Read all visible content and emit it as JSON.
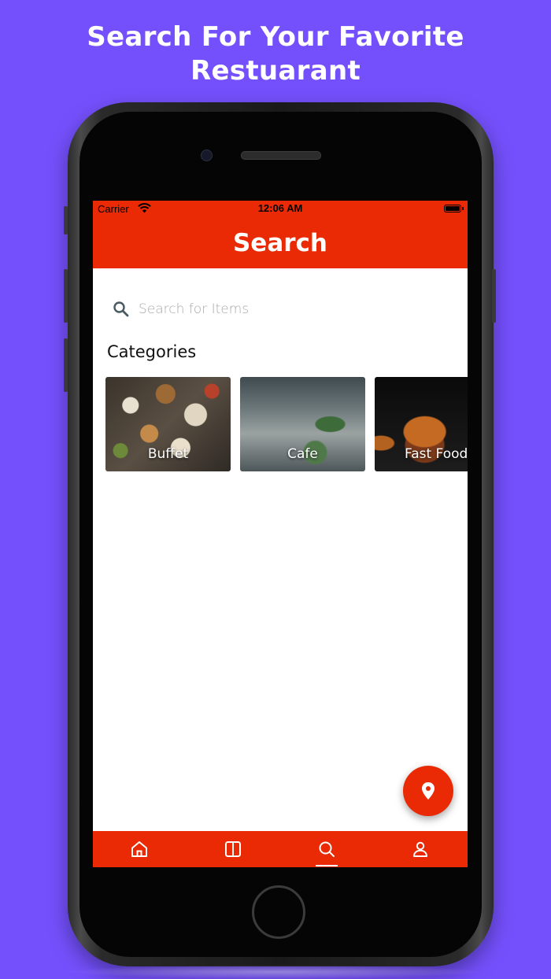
{
  "promo": {
    "headline_line1": "Search For Your Favorite",
    "headline_line2": "Restuarant"
  },
  "status_bar": {
    "carrier": "Carrier",
    "time": "12:06 AM"
  },
  "header": {
    "title": "Search"
  },
  "search": {
    "placeholder": "Search for Items",
    "value": ""
  },
  "categories": {
    "title": "Categories",
    "items": [
      {
        "label": "Buffet"
      },
      {
        "label": "Cafe"
      },
      {
        "label": "Fast Food"
      }
    ]
  },
  "fab": {
    "icon": "location-pin-icon"
  },
  "bottom_nav": {
    "items": [
      {
        "icon": "home-icon",
        "active": false
      },
      {
        "icon": "book-icon",
        "active": false
      },
      {
        "icon": "search-icon",
        "active": true
      },
      {
        "icon": "profile-icon",
        "active": false
      }
    ]
  },
  "colors": {
    "background": "#7450fc",
    "accent": "#e92a05"
  }
}
